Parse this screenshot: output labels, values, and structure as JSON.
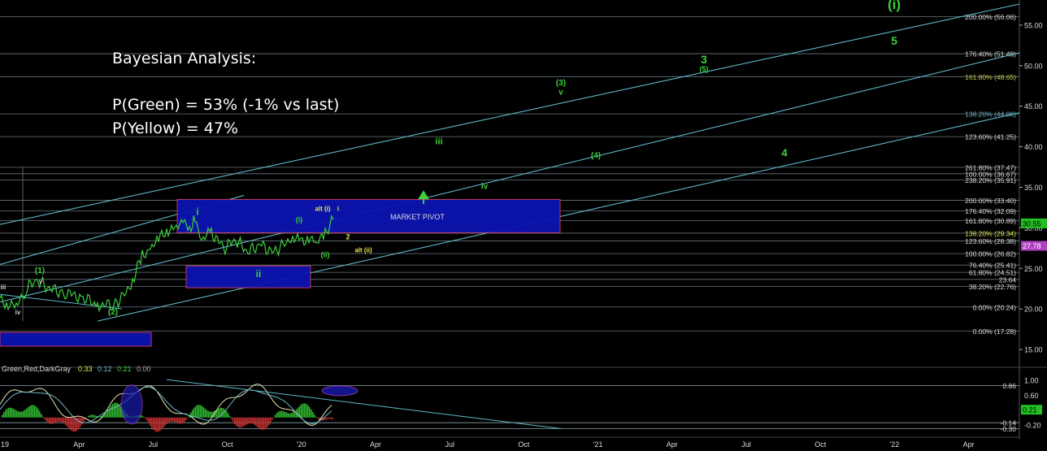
{
  "annotation": {
    "heading": "Bayesian Analysis:",
    "green_probability": "P(Green) = 53% (-1% vs last)",
    "yellow_probability": "P(Yellow) = 47%"
  },
  "chart_data": {
    "type": "line",
    "title": "",
    "x_ticks": [
      "19",
      "Apr",
      "Jul",
      "Oct",
      "'20",
      "Apr",
      "Jul",
      "Oct",
      "'21",
      "Apr",
      "Jul",
      "Oct",
      "'22",
      "Apr"
    ],
    "y_ticks": [
      15,
      20,
      25,
      30,
      35,
      40,
      45,
      50,
      55
    ],
    "ylim": [
      13.5,
      57.5
    ],
    "price_tag": "30.55",
    "secondary_tag": "27.78",
    "price_series": {
      "name": "",
      "points": [
        [
          0,
          21
        ],
        [
          10,
          20.8
        ],
        [
          20,
          20.2
        ],
        [
          32,
          22.5
        ],
        [
          45,
          23.5
        ],
        [
          60,
          22.5
        ],
        [
          80,
          22
        ],
        [
          100,
          21.5
        ],
        [
          120,
          20.5
        ],
        [
          140,
          20.5
        ],
        [
          155,
          22
        ],
        [
          165,
          24
        ],
        [
          175,
          26.5
        ],
        [
          185,
          27.5
        ],
        [
          195,
          28.5
        ],
        [
          205,
          30
        ],
        [
          215,
          29.5
        ],
        [
          225,
          31
        ],
        [
          235,
          30
        ],
        [
          240,
          31.2
        ],
        [
          248,
          28.5
        ],
        [
          260,
          29.5
        ],
        [
          275,
          27.5
        ],
        [
          290,
          28.5
        ],
        [
          305,
          27
        ],
        [
          320,
          28
        ],
        [
          335,
          27
        ],
        [
          350,
          28
        ],
        [
          360,
          29
        ],
        [
          370,
          28
        ],
        [
          380,
          29
        ],
        [
          390,
          28
        ],
        [
          400,
          29.5
        ],
        [
          410,
          31
        ]
      ]
    },
    "fib_levels": [
      {
        "label": "200.00% (56.06)",
        "value": 56.06,
        "color": "#dddddd"
      },
      {
        "label": "176.40% (51.48)",
        "value": 51.48,
        "color": "#dddddd"
      },
      {
        "label": "161.80% (48.65)",
        "value": 48.65,
        "color": "#c8c84a"
      },
      {
        "label": "138.20% (44.06)",
        "value": 44.06,
        "color": "#6fb7c4"
      },
      {
        "label": "123.60% (41.25)",
        "value": 41.25,
        "color": "#dddddd"
      },
      {
        "label": "261.80% (37.47)",
        "value": 37.47,
        "color": "#dddddd"
      },
      {
        "label": "100.00% (36.67)",
        "value": 36.67,
        "color": "#dddddd"
      },
      {
        "label": "238.20% (35.91)",
        "value": 35.91,
        "color": "#dddddd"
      },
      {
        "label": "200.00% (33.40)",
        "value": 33.4,
        "color": "#dddddd"
      },
      {
        "label": "176.40% (32.09)",
        "value": 32.09,
        "color": "#dddddd"
      },
      {
        "label": "161.80% (30.89)",
        "value": 30.89,
        "color": "#dddddd"
      },
      {
        "label": "138.20% (29.34)",
        "value": 29.34,
        "color": "#e6e64a"
      },
      {
        "label": "123.60% (28.38)",
        "value": 28.38,
        "color": "#dddddd"
      },
      {
        "label": "100.00% (26.82)",
        "value": 26.82,
        "color": "#dddddd"
      },
      {
        "label": "76.40% (25.41)",
        "value": 25.41,
        "color": "#dddddd"
      },
      {
        "label": "61.80% (24.51)",
        "value": 24.51,
        "color": "#dddddd"
      },
      {
        "label": "23.64",
        "value": 23.64,
        "color": "#dddddd"
      },
      {
        "label": "38.20% (22.76)",
        "value": 22.76,
        "color": "#dddddd"
      },
      {
        "label": "0.00% (20.24)",
        "value": 20.24,
        "color": "#dddddd"
      },
      {
        "label": "0.00% (17.28)",
        "value": 17.28,
        "color": "#dddddd"
      }
    ],
    "boxes": [
      {
        "label": "MARKET PIVOT",
        "x1": 218,
        "x2": 689,
        "y1": 33.5,
        "y2": 29.4
      },
      {
        "label": "",
        "x1": 229,
        "x2": 382,
        "y1": 25.3,
        "y2": 22.6
      },
      {
        "label": "",
        "x1": 0,
        "x2": 186,
        "y1": 17.1,
        "y2": 15.4
      }
    ],
    "wave_labels": [
      {
        "text": "(i)",
        "x": 1100,
        "y": 57.0,
        "color": "#3cd23c",
        "size": 17
      },
      {
        "text": "5",
        "x": 1100,
        "y": 52.6,
        "color": "#3cd23c",
        "size": 14
      },
      {
        "text": "3",
        "x": 866,
        "y": 50.3,
        "color": "#3cd23c",
        "size": 14
      },
      {
        "text": "(5)",
        "x": 866,
        "y": 49.3,
        "color": "#3cd23c",
        "size": 9
      },
      {
        "text": "(3)",
        "x": 690,
        "y": 47.6,
        "color": "#3cd23c",
        "size": 10
      },
      {
        "text": "v",
        "x": 690,
        "y": 46.4,
        "color": "#3cd23c",
        "size": 10
      },
      {
        "text": "iii",
        "x": 540,
        "y": 40.3,
        "color": "#3cd23c",
        "size": 11
      },
      {
        "text": "4",
        "x": 965,
        "y": 38.8,
        "color": "#3cd23c",
        "size": 13
      },
      {
        "text": "(4)",
        "x": 733,
        "y": 38.6,
        "color": "#3cd23c",
        "size": 10
      },
      {
        "text": "iv",
        "x": 596,
        "y": 34.8,
        "color": "#3cd23c",
        "size": 10
      },
      {
        "text": "i",
        "x": 243,
        "y": 31.6,
        "color": "#3cd23c",
        "size": 12
      },
      {
        "text": "alt (i)",
        "x": 397,
        "y": 32.1,
        "color": "#e6e64a",
        "size": 8
      },
      {
        "text": "i",
        "x": 416,
        "y": 32.1,
        "color": "#e6e64a",
        "size": 8
      },
      {
        "text": "(i)",
        "x": 368,
        "y": 30.7,
        "color": "#3cd23c",
        "size": 9
      },
      {
        "text": "2",
        "x": 428,
        "y": 28.6,
        "color": "#e6e64a",
        "size": 9
      },
      {
        "text": "alt (ii)",
        "x": 447,
        "y": 27.0,
        "color": "#e6e64a",
        "size": 8
      },
      {
        "text": "(ii)",
        "x": 400,
        "y": 26.4,
        "color": "#3cd23c",
        "size": 9
      },
      {
        "text": "ii",
        "x": 318,
        "y": 23.9,
        "color": "#3cd23c",
        "size": 12
      },
      {
        "text": "(1)",
        "x": 49,
        "y": 24.4,
        "color": "#3cd23c",
        "size": 10
      },
      {
        "text": "v",
        "x": 50,
        "y": 23.1,
        "color": "#cccccc",
        "size": 8
      },
      {
        "text": "iii",
        "x": 4,
        "y": 22.4,
        "color": "#cccccc",
        "size": 8
      },
      {
        "text": "iv",
        "x": 22,
        "y": 19.3,
        "color": "#cccccc",
        "size": 8
      },
      {
        "text": "(2)",
        "x": 139,
        "y": 19.3,
        "color": "#3cd23c",
        "size": 10
      }
    ],
    "indicator": {
      "legend": "Green,Red,DarkGray",
      "legend_values": [
        {
          "text": "0.33",
          "color": "#e6e64a"
        },
        {
          "text": "0.12",
          "color": "#6fb7c4"
        },
        {
          "text": "0.21",
          "color": "#3cd23c"
        },
        {
          "text": "0.00",
          "color": "#aaaaaa"
        }
      ],
      "y_ticks": [
        1.0,
        0.6,
        0.2,
        -0.2
      ],
      "ylim": [
        -0.42,
        1.22
      ],
      "levels": [
        {
          "label": "0.86",
          "value": 0.86
        },
        {
          "label": "-0.14",
          "value": -0.14
        },
        {
          "label": "-0.30",
          "value": -0.3
        }
      ],
      "value_tag": "0.21"
    }
  }
}
